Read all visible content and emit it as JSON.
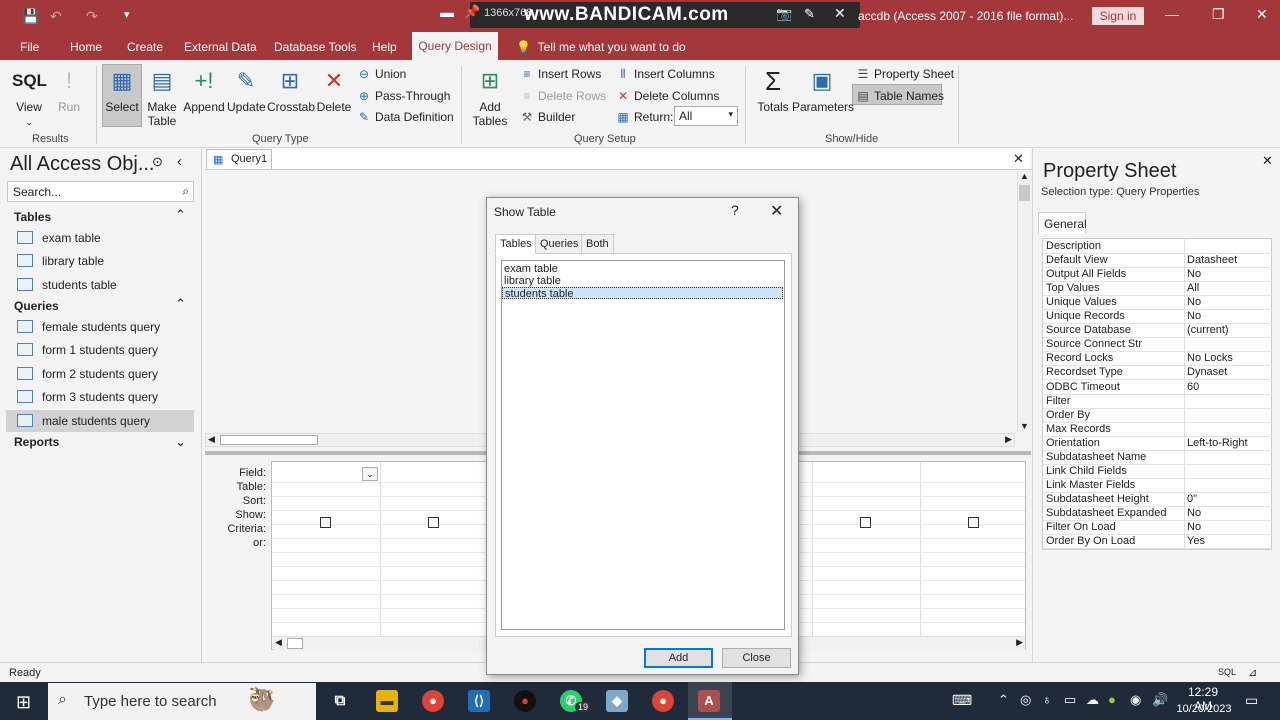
{
  "window": {
    "title": "accdb (Access 2007 - 2016 file format)...",
    "sign_in": "Sign in"
  },
  "overlay": {
    "resolution": "1366x768",
    "watermark": "www.BANDICAM.com"
  },
  "menu": {
    "items": [
      "File",
      "Home",
      "Create",
      "External Data",
      "Database Tools",
      "Help"
    ],
    "active": "Query Design",
    "tell_me": "Tell me what you want to do"
  },
  "ribbon": {
    "sql": "SQL",
    "view": "View",
    "run": "Run",
    "select": "Select",
    "make_table_1": "Make",
    "make_table_2": "Table",
    "append": "Append",
    "update": "Update",
    "crosstab": "Crosstab",
    "delete": "Delete",
    "union": "Union",
    "pass_through": "Pass-Through",
    "data_definition": "Data Definition",
    "add_tables_1": "Add",
    "add_tables_2": "Tables",
    "insert_rows": "Insert Rows",
    "delete_rows": "Delete Rows",
    "builder": "Builder",
    "insert_columns": "Insert Columns",
    "delete_columns": "Delete Columns",
    "return_label": "Return:",
    "return_value": "All",
    "totals": "Totals",
    "parameters": "Parameters",
    "property_sheet": "Property Sheet",
    "table_names": "Table Names",
    "groups": {
      "results": "Results",
      "query_type": "Query Type",
      "query_setup": "Query Setup",
      "show_hide": "Show/Hide"
    }
  },
  "nav": {
    "title": "All Access Obj...",
    "search_placeholder": "Search...",
    "tables_header": "Tables",
    "tables": [
      "exam table",
      "library table",
      "students table"
    ],
    "queries_header": "Queries",
    "queries": [
      "female students query",
      "form 1 students query",
      "form 2 students query",
      "form 3 students query",
      "male students query"
    ],
    "reports_header": "Reports"
  },
  "document": {
    "tab": "Query1",
    "row_labels": [
      "Field:",
      "Table:",
      "Sort:",
      "Show:",
      "Criteria:",
      "or:"
    ]
  },
  "property_sheet": {
    "title": "Property Sheet",
    "selection_type": "Selection type:  Query Properties",
    "tab": "General",
    "rows": [
      [
        "Description",
        ""
      ],
      [
        "Default View",
        "Datasheet"
      ],
      [
        "Output All Fields",
        "No"
      ],
      [
        "Top Values",
        "All"
      ],
      [
        "Unique Values",
        "No"
      ],
      [
        "Unique Records",
        "No"
      ],
      [
        "Source Database",
        "(current)"
      ],
      [
        "Source Connect Str",
        ""
      ],
      [
        "Record Locks",
        "No Locks"
      ],
      [
        "Recordset Type",
        "Dynaset"
      ],
      [
        "ODBC Timeout",
        "60"
      ],
      [
        "Filter",
        ""
      ],
      [
        "Order By",
        ""
      ],
      [
        "Max Records",
        ""
      ],
      [
        "Orientation",
        "Left-to-Right"
      ],
      [
        "Subdatasheet Name",
        ""
      ],
      [
        "Link Child Fields",
        ""
      ],
      [
        "Link Master Fields",
        ""
      ],
      [
        "Subdatasheet Height",
        "0\""
      ],
      [
        "Subdatasheet Expanded",
        "No"
      ],
      [
        "Filter On Load",
        "No"
      ],
      [
        "Order By On Load",
        "Yes"
      ]
    ]
  },
  "dialog": {
    "title": "Show Table",
    "help": "?",
    "tabs": [
      "Tables",
      "Queries",
      "Both"
    ],
    "items": [
      "exam table",
      "library table",
      "students table"
    ],
    "selected": "students table",
    "add": "Add",
    "close": "Close"
  },
  "status": {
    "left": "Ready",
    "right": "SQL"
  },
  "taskbar": {
    "search_placeholder": "Type here to search",
    "time": "12:29 AM",
    "date": "10/20/2023",
    "whatsapp_badge": "19"
  }
}
